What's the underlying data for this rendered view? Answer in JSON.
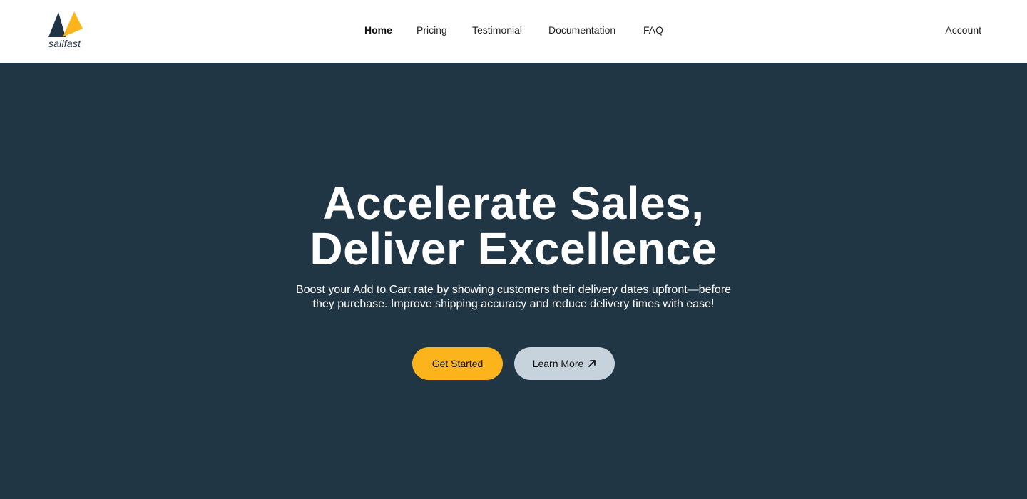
{
  "brand": {
    "name": "sailfast",
    "colors": {
      "dark": "#1f3545",
      "accent": "#fbb41c"
    }
  },
  "nav": {
    "items": [
      {
        "label": "Home",
        "active": true
      },
      {
        "label": "Pricing",
        "active": false
      },
      {
        "label": "Testimonial",
        "active": false
      },
      {
        "label": "Documentation",
        "active": false
      },
      {
        "label": "FAQ",
        "active": false
      }
    ],
    "account_label": "Account"
  },
  "hero": {
    "title_line1": "Accelerate Sales,",
    "title_line2": "Deliver Excellence",
    "subtitle": "Boost your Add to Cart rate by showing customers their delivery dates upfront—before they purchase. Improve shipping accuracy and reduce delivery times with ease!",
    "primary_button": "Get Started",
    "secondary_button": "Learn More",
    "secondary_icon": "arrow-up-right-icon",
    "background_color": "#213645",
    "primary_button_color": "#fbb41c",
    "secondary_button_color": "#c7d3dc"
  }
}
